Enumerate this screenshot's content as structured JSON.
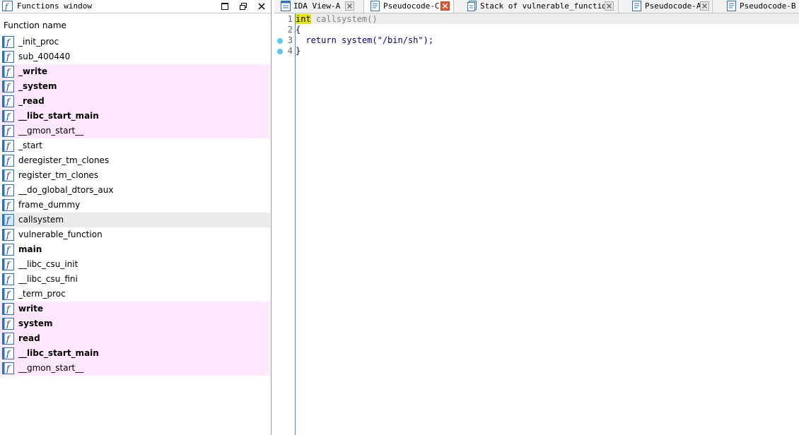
{
  "functions_window": {
    "title": "Functions window",
    "column_header": "Function name",
    "functions": [
      {
        "name": "_init_proc",
        "bold": false,
        "imported": false,
        "selected": false
      },
      {
        "name": "sub_400440",
        "bold": false,
        "imported": false,
        "selected": false
      },
      {
        "name": "_write",
        "bold": true,
        "imported": true,
        "selected": false
      },
      {
        "name": "_system",
        "bold": true,
        "imported": true,
        "selected": false
      },
      {
        "name": "_read",
        "bold": true,
        "imported": true,
        "selected": false
      },
      {
        "name": "__libc_start_main",
        "bold": true,
        "imported": true,
        "selected": false
      },
      {
        "name": "__gmon_start__",
        "bold": false,
        "imported": true,
        "selected": false
      },
      {
        "name": "_start",
        "bold": false,
        "imported": false,
        "selected": false
      },
      {
        "name": "deregister_tm_clones",
        "bold": false,
        "imported": false,
        "selected": false
      },
      {
        "name": "register_tm_clones",
        "bold": false,
        "imported": false,
        "selected": false
      },
      {
        "name": "__do_global_dtors_aux",
        "bold": false,
        "imported": false,
        "selected": false
      },
      {
        "name": "frame_dummy",
        "bold": false,
        "imported": false,
        "selected": false
      },
      {
        "name": "callsystem",
        "bold": false,
        "imported": false,
        "selected": true
      },
      {
        "name": "vulnerable_function",
        "bold": false,
        "imported": false,
        "selected": false
      },
      {
        "name": "main",
        "bold": true,
        "imported": false,
        "selected": false
      },
      {
        "name": "__libc_csu_init",
        "bold": false,
        "imported": false,
        "selected": false
      },
      {
        "name": "__libc_csu_fini",
        "bold": false,
        "imported": false,
        "selected": false
      },
      {
        "name": "_term_proc",
        "bold": false,
        "imported": false,
        "selected": false
      },
      {
        "name": "write",
        "bold": true,
        "imported": true,
        "selected": false
      },
      {
        "name": "system",
        "bold": true,
        "imported": true,
        "selected": false
      },
      {
        "name": "read",
        "bold": true,
        "imported": true,
        "selected": false
      },
      {
        "name": "__libc_start_main",
        "bold": true,
        "imported": true,
        "selected": false
      },
      {
        "name": "__gmon_start__",
        "bold": false,
        "imported": true,
        "selected": false
      }
    ]
  },
  "tabs": [
    {
      "label": "IDA View-A",
      "active": false,
      "icon": "disassembly-view-icon"
    },
    {
      "label": "Pseudocode-C",
      "active": true,
      "icon": "pseudocode-icon"
    },
    {
      "label": "Stack of vulnerable_function",
      "active": false,
      "icon": "stack-icon"
    },
    {
      "label": "Pseudocode-A",
      "active": false,
      "icon": "pseudocode-icon"
    },
    {
      "label": "Pseudocode-B",
      "active": false,
      "icon": "pseudocode-icon"
    }
  ],
  "code": {
    "lines": [
      {
        "number": "1",
        "breakpoint": false
      },
      {
        "number": "2",
        "breakpoint": false
      },
      {
        "number": "3",
        "breakpoint": true
      },
      {
        "number": "4",
        "breakpoint": true
      }
    ],
    "l1_type": "int",
    "l1_rest": " callsystem()",
    "l2": "{",
    "l3": "  return system(\"/bin/sh\");",
    "l4": "}"
  },
  "colors": {
    "imported_highlight": "#ffe7fd",
    "selected_row": "#ebebeb",
    "keyword_highlight": "#e6e600",
    "code_text": "#000080",
    "breakpoint_dot": "#5ac8f0",
    "active_tab_close": "#e05a3a"
  }
}
